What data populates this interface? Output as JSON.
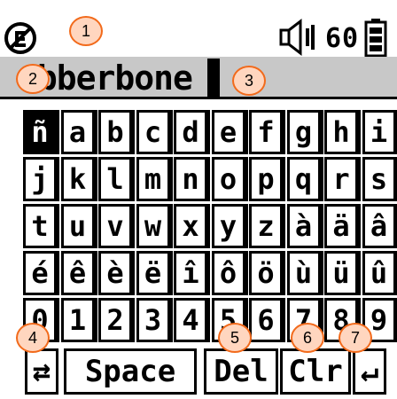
{
  "status": {
    "volume_value": "60"
  },
  "input": {
    "typed_text": "ubberbone"
  },
  "keyboard": {
    "rows": [
      [
        "ñ",
        "a",
        "b",
        "c",
        "d",
        "e",
        "f",
        "g",
        "h",
        "i"
      ],
      [
        "j",
        "k",
        "l",
        "m",
        "n",
        "o",
        "p",
        "q",
        "r",
        "s"
      ],
      [
        "t",
        "u",
        "v",
        "w",
        "x",
        "y",
        "z",
        "à",
        "ä",
        "â"
      ],
      [
        "é",
        "ê",
        "è",
        "ë",
        "î",
        "ô",
        "ö",
        "ù",
        "ü",
        "û"
      ],
      [
        "0",
        "1",
        "2",
        "3",
        "4",
        "5",
        "6",
        "7",
        "8",
        "9"
      ]
    ],
    "selected_key": "ñ",
    "bottom": {
      "toggle_symbol": "⇄",
      "space_label": "Space",
      "del_label": "Del",
      "clr_label": "Clr",
      "enter_symbol": "↵"
    }
  },
  "callouts": [
    "1",
    "2",
    "3",
    "4",
    "5",
    "6",
    "7"
  ],
  "colors": {
    "callout_fill": "#ffd6bf",
    "callout_border": "#f26a1b",
    "textline_bg": "#c8c8c8"
  },
  "icons": {
    "lock": "key-lock-icon",
    "volume": "speaker-volume-icon",
    "battery": "battery-icon"
  }
}
